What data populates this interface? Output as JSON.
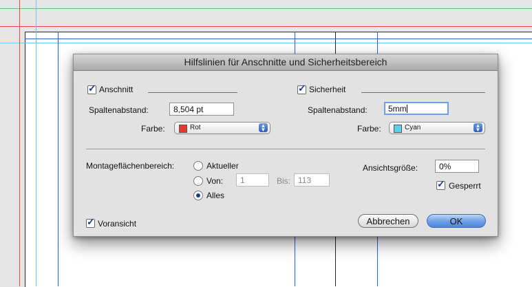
{
  "dialog": {
    "title": "Hilfslinien für Anschnitte und Sicherheitsbereich"
  },
  "bleed": {
    "label": "Anschnitt",
    "checked": true,
    "spacing_label": "Spaltenabstand:",
    "spacing_value": "8,504 pt",
    "color_label": "Farbe:",
    "color_value": "Rot",
    "color_swatch": "#e8372c"
  },
  "safety": {
    "label": "Sicherheit",
    "checked": true,
    "spacing_label": "Spaltenabstand:",
    "spacing_value": "5mm",
    "color_label": "Farbe:",
    "color_value": "Cyan",
    "color_swatch": "#5ad0ea"
  },
  "artboard_range": {
    "label": "Montageflächenbereich:",
    "options": [
      "Aktueller",
      "Von:",
      "Alles"
    ],
    "selected": "Alles",
    "from_value": "1",
    "to_label": "Bis:",
    "to_value": "113"
  },
  "view": {
    "size_label": "Ansichtsgröße:",
    "size_value": "0%",
    "locked_label": "Gesperrt",
    "locked_checked": true
  },
  "preview": {
    "label": "Voransicht",
    "checked": true
  },
  "buttons": {
    "cancel": "Abbrechen",
    "ok": "OK"
  },
  "colors": {
    "guide_cyan": "#6fc9ef",
    "guide_blue": "#2b5fd0",
    "guide_red": "#e04a3c",
    "guide_green": "#6cc06a"
  }
}
